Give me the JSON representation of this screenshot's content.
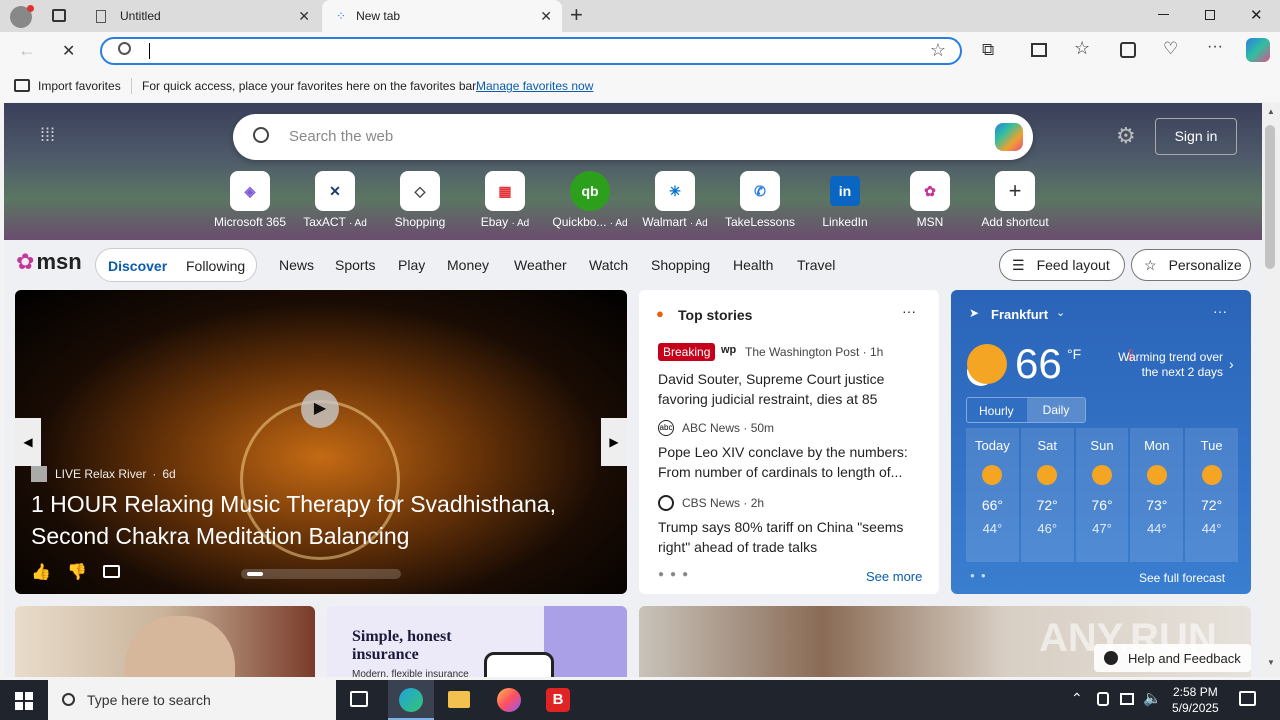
{
  "tabs": [
    {
      "title": "Untitled"
    },
    {
      "title": "New tab"
    }
  ],
  "favbar": {
    "import": "Import favorites",
    "message": "For quick access, place your favorites here on the favorites bar.",
    "manage_link": "Manage favorites now"
  },
  "search": {
    "placeholder": "Search the web"
  },
  "signin": "Sign in",
  "shortcuts": [
    {
      "label": "Microsoft 365",
      "ad": "",
      "glyph": "◈",
      "color": "#7b5cd6"
    },
    {
      "label": "TaxACT",
      "ad": "· Ad",
      "glyph": "✕",
      "color": "#1b3d6d"
    },
    {
      "label": "Shopping",
      "ad": "",
      "glyph": "🏷",
      "color": "#444"
    },
    {
      "label": "Ebay",
      "ad": "· Ad",
      "glyph": "▦",
      "color": "#e53238"
    },
    {
      "label": "Quickbo...",
      "ad": "· Ad",
      "glyph": "qb",
      "color": "#2ca01c"
    },
    {
      "label": "Walmart",
      "ad": "· Ad",
      "glyph": "✳",
      "color": "#0071ce"
    },
    {
      "label": "TakeLessons",
      "ad": "",
      "glyph": "✆",
      "color": "#2a7de1"
    },
    {
      "label": "LinkedIn",
      "ad": "",
      "glyph": "in",
      "color": "#0a66c2"
    },
    {
      "label": "MSN",
      "ad": "",
      "glyph": "✿",
      "color": "#c2399b"
    },
    {
      "label": "Add shortcut",
      "ad": "",
      "glyph": "+",
      "color": "#333"
    }
  ],
  "msn": {
    "logo": "msn",
    "discover": "Discover",
    "following": "Following",
    "nav": [
      "News",
      "Sports",
      "Play",
      "Money",
      "Weather",
      "Watch",
      "Shopping",
      "Health",
      "Travel"
    ],
    "feed_layout": "Feed layout",
    "personalize": "Personalize"
  },
  "hero_card": {
    "source": "LIVE Relax River",
    "age": "6d",
    "title": "1 HOUR Relaxing Music Therapy for Svadhisthana, Second Chakra Meditation Balancing"
  },
  "top_stories": {
    "header": "Top stories",
    "see_more": "See more",
    "items": [
      {
        "badge": "Breaking",
        "source": "The Washington Post",
        "age": "1h",
        "headline": "David Souter, Supreme Court justice favoring judicial restraint, dies at 85"
      },
      {
        "badge": "",
        "source": "ABC News",
        "age": "50m",
        "headline": "Pope Leo XIV conclave by the numbers: From number of cardinals to length of..."
      },
      {
        "badge": "",
        "source": "CBS News",
        "age": "2h",
        "headline": "Trump says 80% tariff on China \"seems right\" ahead of trade talks"
      }
    ]
  },
  "weather": {
    "city": "Frankfurt",
    "temp": "66",
    "unit": "°F",
    "trend": "Warming trend over the next 2 days",
    "tab_hourly": "Hourly",
    "tab_daily": "Daily",
    "see_full": "See full forecast",
    "days": [
      {
        "day": "Today",
        "hi": "66°",
        "lo": "44°"
      },
      {
        "day": "Sat",
        "hi": "72°",
        "lo": "46°"
      },
      {
        "day": "Sun",
        "hi": "76°",
        "lo": "47°"
      },
      {
        "day": "Mon",
        "hi": "73°",
        "lo": "44°"
      },
      {
        "day": "Tue",
        "hi": "72°",
        "lo": "44°"
      }
    ]
  },
  "ad_card": {
    "title": "Simple, honest insurance",
    "sub": "Modern, flexible insurance"
  },
  "help": "Help and Feedback",
  "watermark": "ANY.RUN",
  "taskbar": {
    "search_placeholder": "Type here to search",
    "time": "2:58 PM",
    "date": "5/9/2025"
  }
}
